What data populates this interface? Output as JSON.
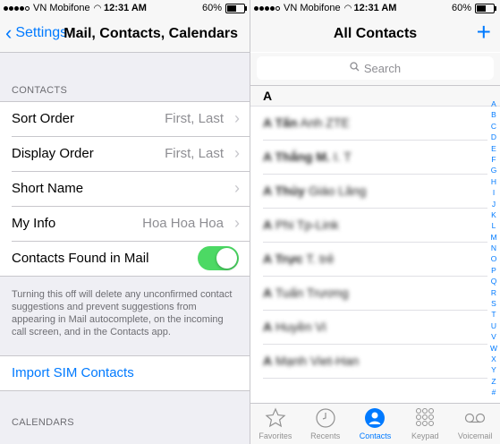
{
  "left_status": {
    "carrier": "VN Mobifone",
    "time": "12:31 AM",
    "battery": "60%"
  },
  "right_status": {
    "carrier": "VN Mobifone",
    "time": "12:31 AM",
    "battery": "60%"
  },
  "battery_level": 0.6,
  "left_nav": {
    "back_label": "Settings",
    "title": "Mail, Contacts, Calendars"
  },
  "contacts_section": {
    "header": "CONTACTS",
    "rows": [
      {
        "label": "Sort Order",
        "value": "First, Last"
      },
      {
        "label": "Display Order",
        "value": "First, Last"
      },
      {
        "label": "Short Name",
        "value": ""
      },
      {
        "label": "My Info",
        "value": "Hoa Hoa Hoa"
      }
    ],
    "toggle_row": {
      "label": "Contacts Found in Mail",
      "on": true
    },
    "footer": "Turning this off will delete any unconfirmed contact suggestions and prevent suggestions from appearing in Mail autocomplete, on the incoming call screen, and in the Contacts app."
  },
  "import_sim": "Import SIM Contacts",
  "calendars_header": "CALENDARS",
  "right_nav": {
    "title": "All Contacts",
    "add": "+"
  },
  "search": {
    "placeholder": "Search"
  },
  "section_letter": "A",
  "contacts": [
    {
      "first": "A Tấn",
      "rest": "Anh ZTE"
    },
    {
      "first": "A Thắng M.",
      "rest": "I. T"
    },
    {
      "first": "A Thủy",
      "rest": "Giáo Lăng"
    },
    {
      "first": "A",
      "rest": "Phi Tp-Link"
    },
    {
      "first": "A Trực",
      "rest": "T. trẻ"
    },
    {
      "first": "A",
      "rest": "Tuấn Trương"
    },
    {
      "first": "A",
      "rest": "Huyền Vi"
    },
    {
      "first": "A",
      "rest": "Mạnh Viet-Han"
    }
  ],
  "index_letters": [
    "A",
    "B",
    "C",
    "D",
    "E",
    "F",
    "G",
    "H",
    "I",
    "J",
    "K",
    "L",
    "M",
    "N",
    "O",
    "P",
    "Q",
    "R",
    "S",
    "T",
    "U",
    "V",
    "W",
    "X",
    "Y",
    "Z",
    "#"
  ],
  "tabs": [
    {
      "label": "Favorites",
      "icon": "star-icon",
      "active": false
    },
    {
      "label": "Recents",
      "icon": "clock-icon",
      "active": false
    },
    {
      "label": "Contacts",
      "icon": "person-icon",
      "active": true
    },
    {
      "label": "Keypad",
      "icon": "keypad-icon",
      "active": false
    },
    {
      "label": "Voicemail",
      "icon": "voicemail-icon",
      "active": false
    }
  ],
  "colors": {
    "accent": "#007aff",
    "toggle_on": "#4cd964",
    "background": "#efeff4"
  }
}
